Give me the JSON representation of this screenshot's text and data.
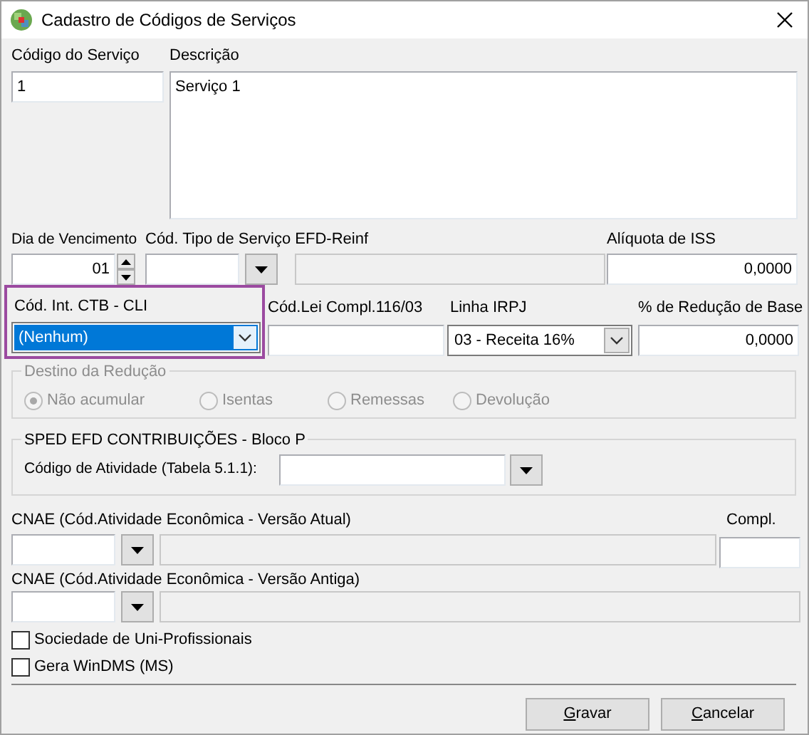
{
  "window": {
    "title": "Cadastro de Códigos de Serviços"
  },
  "codigo_servico": {
    "label": "Código do Serviço",
    "value": "1"
  },
  "descricao": {
    "label": "Descrição",
    "value": "Serviço 1"
  },
  "dia_vencimento": {
    "label": "Dia de Vencimento",
    "value": "01"
  },
  "tipo_servico_reinf": {
    "label": "Cód. Tipo de Serviço EFD-Reinf"
  },
  "aliquota_iss": {
    "label": "Alíquota de ISS",
    "value": "0,0000"
  },
  "cod_int_ctb": {
    "label": "Cód. Int. CTB - CLI",
    "value": "(Nenhum)",
    "focused": true
  },
  "cod_lei": {
    "label": "Cód.Lei Compl.116/03"
  },
  "linha_irpj": {
    "label": "Linha IRPJ",
    "value": "03 - Receita 16%"
  },
  "reducao_base": {
    "label": "% de Redução de Base",
    "value": "0,0000"
  },
  "destino_reducao": {
    "title": "Destino da Redução",
    "disabled": true,
    "options": [
      {
        "label": "Não acumular",
        "selected": true
      },
      {
        "label": "Isentas",
        "selected": false
      },
      {
        "label": "Remessas",
        "selected": false
      },
      {
        "label": "Devolução",
        "selected": false
      }
    ]
  },
  "sped": {
    "title": "SPED EFD CONTRIBUIÇÕES - Bloco P",
    "label": "Código de Atividade (Tabela 5.1.1):"
  },
  "cnae_atual": {
    "label": "CNAE (Cód.Atividade Econômica - Versão Atual)",
    "compl_label": "Compl."
  },
  "cnae_antiga": {
    "label": "CNAE (Cód.Atividade Econômica - Versão Antiga)"
  },
  "checkboxes": [
    {
      "label": "Sociedade de Uni-Profissionais",
      "checked": false
    },
    {
      "label": "Gera WinDMS (MS)",
      "checked": false
    }
  ],
  "buttons": [
    {
      "label": "Gravar"
    },
    {
      "label": "Cancelar"
    }
  ]
}
